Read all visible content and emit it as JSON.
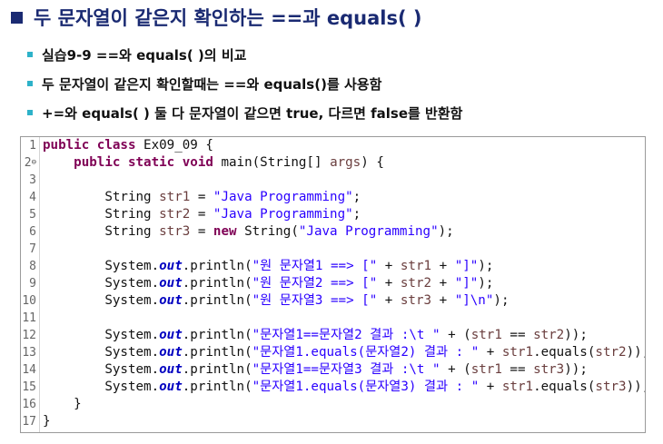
{
  "title": "두 문자열이 같은지 확인하는 ==과 equals( )",
  "bullets": [
    "실습9-9 ==와 equals( )의 비교",
    "두 문자열이 같은지 확인할때는 ==와 equals()를 사용함",
    "+=와 equals( ) 둘 다 문자열이 같으면 true, 다르면 false를 반환함"
  ],
  "code": {
    "line_numbers": [
      "1",
      "2",
      "3",
      "4",
      "5",
      "6",
      "7",
      "8",
      "9",
      "10",
      "11",
      "12",
      "13",
      "14",
      "15",
      "16",
      "17"
    ],
    "fold_marker": "⊖",
    "lines": [
      [
        [
          "kw",
          "public"
        ],
        [
          "t",
          " "
        ],
        [
          "kw",
          "class"
        ],
        [
          "t",
          " Ex09_09 {"
        ]
      ],
      [
        [
          "t",
          "    "
        ],
        [
          "kw",
          "public"
        ],
        [
          "t",
          " "
        ],
        [
          "kw",
          "static"
        ],
        [
          "t",
          " "
        ],
        [
          "kw",
          "void"
        ],
        [
          "t",
          " main(String[] "
        ],
        [
          "var",
          "args"
        ],
        [
          "t",
          ") {"
        ]
      ],
      [],
      [
        [
          "t",
          "        String "
        ],
        [
          "var",
          "str1"
        ],
        [
          "t",
          " = "
        ],
        [
          "str",
          "\"Java Programming\""
        ],
        [
          "t",
          ";"
        ]
      ],
      [
        [
          "t",
          "        String "
        ],
        [
          "var",
          "str2"
        ],
        [
          "t",
          " = "
        ],
        [
          "str",
          "\"Java Programming\""
        ],
        [
          "t",
          ";"
        ]
      ],
      [
        [
          "t",
          "        String "
        ],
        [
          "var",
          "str3"
        ],
        [
          "t",
          " = "
        ],
        [
          "kw",
          "new"
        ],
        [
          "t",
          " String("
        ],
        [
          "str",
          "\"Java Programming\""
        ],
        [
          "t",
          ");"
        ]
      ],
      [],
      [
        [
          "t",
          "        System."
        ],
        [
          "fld",
          "out"
        ],
        [
          "t",
          ".println("
        ],
        [
          "str",
          "\"원 문자열1 ==> [\""
        ],
        [
          "t",
          " + "
        ],
        [
          "var",
          "str1"
        ],
        [
          "t",
          " + "
        ],
        [
          "str",
          "\"]\""
        ],
        [
          "t",
          ");"
        ]
      ],
      [
        [
          "t",
          "        System."
        ],
        [
          "fld",
          "out"
        ],
        [
          "t",
          ".println("
        ],
        [
          "str",
          "\"원 문자열2 ==> [\""
        ],
        [
          "t",
          " + "
        ],
        [
          "var",
          "str2"
        ],
        [
          "t",
          " + "
        ],
        [
          "str",
          "\"]\""
        ],
        [
          "t",
          ");"
        ]
      ],
      [
        [
          "t",
          "        System."
        ],
        [
          "fld",
          "out"
        ],
        [
          "t",
          ".println("
        ],
        [
          "str",
          "\"원 문자열3 ==> [\""
        ],
        [
          "t",
          " + "
        ],
        [
          "var",
          "str3"
        ],
        [
          "t",
          " + "
        ],
        [
          "str",
          "\"]\\n\""
        ],
        [
          "t",
          ");"
        ]
      ],
      [],
      [
        [
          "t",
          "        System."
        ],
        [
          "fld",
          "out"
        ],
        [
          "t",
          ".println("
        ],
        [
          "str",
          "\"문자열1==문자열2 결과 :\\t \""
        ],
        [
          "t",
          " + ("
        ],
        [
          "var",
          "str1"
        ],
        [
          "t",
          " == "
        ],
        [
          "var",
          "str2"
        ],
        [
          "t",
          "));"
        ]
      ],
      [
        [
          "t",
          "        System."
        ],
        [
          "fld",
          "out"
        ],
        [
          "t",
          ".println("
        ],
        [
          "str",
          "\"문자열1.equals(문자열2) 결과 : \""
        ],
        [
          "t",
          " + "
        ],
        [
          "var",
          "str1"
        ],
        [
          "t",
          ".equals("
        ],
        [
          "var",
          "str2"
        ],
        [
          "t",
          "));"
        ]
      ],
      [
        [
          "t",
          "        System."
        ],
        [
          "fld",
          "out"
        ],
        [
          "t",
          ".println("
        ],
        [
          "str",
          "\"문자열1==문자열3 결과 :\\t \""
        ],
        [
          "t",
          " + ("
        ],
        [
          "var",
          "str1"
        ],
        [
          "t",
          " == "
        ],
        [
          "var",
          "str3"
        ],
        [
          "t",
          "));"
        ]
      ],
      [
        [
          "t",
          "        System."
        ],
        [
          "fld",
          "out"
        ],
        [
          "t",
          ".println("
        ],
        [
          "str",
          "\"문자열1.equals(문자열3) 결과 : \""
        ],
        [
          "t",
          " + "
        ],
        [
          "var",
          "str1"
        ],
        [
          "t",
          ".equals("
        ],
        [
          "var",
          "str3"
        ],
        [
          "t",
          "));"
        ]
      ],
      [
        [
          "t",
          "    }"
        ]
      ],
      [
        [
          "t",
          "}"
        ]
      ]
    ]
  }
}
